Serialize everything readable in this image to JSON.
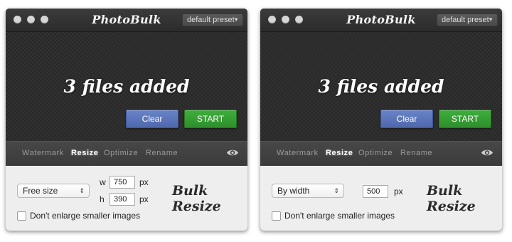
{
  "left": {
    "app_title": "PhotoBulk",
    "preset": "default preset",
    "files_added": "3 files added",
    "clear_label": "Clear",
    "start_label": "START",
    "tabs": [
      "Watermark",
      "Resize",
      "Optimize",
      "Rename"
    ],
    "active_tab": "Resize",
    "resize_mode": "Free size",
    "width_label": "w",
    "width_value": "750",
    "height_label": "h",
    "height_value": "390",
    "unit": "px",
    "panel_title": "Bulk Resize",
    "checkbox_label": "Don't enlarge smaller images"
  },
  "right": {
    "app_title": "PhotoBulk",
    "preset": "default preset",
    "files_added": "3 files added",
    "clear_label": "Clear",
    "start_label": "START",
    "tabs": [
      "Watermark",
      "Resize",
      "Optimize",
      "Rename"
    ],
    "active_tab": "Resize",
    "resize_mode": "By width",
    "width_value": "500",
    "unit": "px",
    "panel_title": "Bulk Resize",
    "checkbox_label": "Don't enlarge smaller images"
  },
  "icons": {
    "traffic_lights": "window-controls",
    "caret": "triangle-down-icon",
    "select_chevron": "updown-chevron-icon",
    "eye": "eye-icon"
  },
  "colors": {
    "clear_button": "#5b74bb",
    "start_button": "#35a033",
    "tab_active": "#ffffff",
    "tab_inactive": "#9b9b9b"
  }
}
